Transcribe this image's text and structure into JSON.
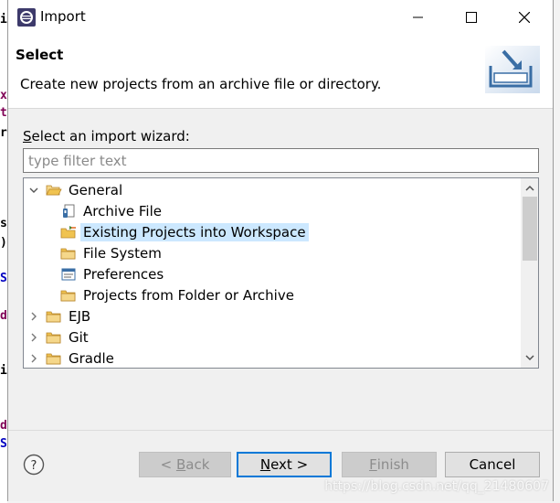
{
  "editor": {
    "chars": [
      {
        "ch": "i",
        "color": "#000000"
      },
      {
        "ch": "x",
        "color": "#7f0055"
      },
      {
        "ch": "t",
        "color": "#7f0055"
      },
      {
        "ch": "r",
        "color": "#000000"
      },
      {
        "ch": "s",
        "color": "#000000"
      },
      {
        "ch": ")",
        "color": "#000000"
      },
      {
        "ch": "S",
        "color": "#0000c0"
      },
      {
        "ch": "d",
        "color": "#7f0055"
      },
      {
        "ch": "i",
        "color": "#000000"
      },
      {
        "ch": "d",
        "color": "#7f0055"
      },
      {
        "ch": "S",
        "color": "#0000c0"
      }
    ]
  },
  "window": {
    "title": "Import",
    "minimize_icon": "minimize-icon",
    "maximize_icon": "maximize-icon",
    "close_icon": "close-icon"
  },
  "header": {
    "title": "Select",
    "description": "Create new projects from an archive file or directory.",
    "image_icon": "import-wizard-icon"
  },
  "wizard": {
    "label_mnemonic": "S",
    "label_rest": "elect an import wizard:",
    "filter_placeholder": "type filter text",
    "filter_value": ""
  },
  "tree": {
    "items": [
      {
        "label": "General",
        "icon": "folder-open-icon",
        "expanded": true,
        "level": 0,
        "selected": false
      },
      {
        "label": "Archive File",
        "icon": "archive-file-icon",
        "level": 1,
        "selected": false
      },
      {
        "label": "Existing Projects into Workspace",
        "icon": "existing-projects-icon",
        "level": 1,
        "selected": true
      },
      {
        "label": "File System",
        "icon": "folder-icon",
        "level": 1,
        "selected": false
      },
      {
        "label": "Preferences",
        "icon": "preferences-icon",
        "level": 1,
        "selected": false
      },
      {
        "label": "Projects from Folder or Archive",
        "icon": "folder-icon",
        "level": 1,
        "selected": false
      },
      {
        "label": "EJB",
        "icon": "folder-icon",
        "expanded": false,
        "level": 0,
        "selected": false
      },
      {
        "label": "Git",
        "icon": "folder-icon",
        "expanded": false,
        "level": 0,
        "selected": false
      },
      {
        "label": "Gradle",
        "icon": "folder-icon",
        "expanded": false,
        "level": 0,
        "selected": false
      }
    ]
  },
  "buttons": {
    "help_icon": "help-icon",
    "back_prefix": "< ",
    "back_mnemonic": "B",
    "back_rest": "ack",
    "next_mnemonic": "N",
    "next_rest": "ext >",
    "finish_mnemonic": "F",
    "finish_rest": "inish",
    "cancel": "Cancel"
  },
  "watermark": "https://blog.csdn.net/qq_21480607",
  "colors": {
    "accent": "#0078d7",
    "selection": "#cce8ff",
    "folder": "#e8b84a"
  }
}
